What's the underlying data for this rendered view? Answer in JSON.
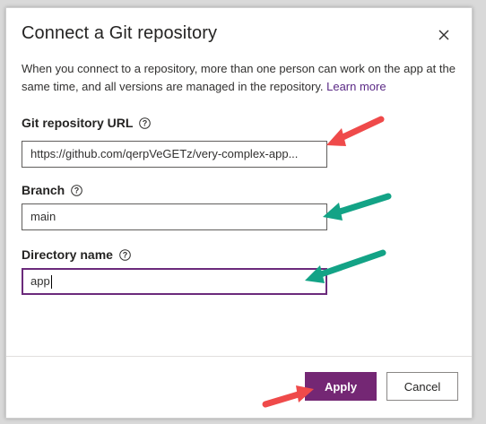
{
  "dialog": {
    "title": "Connect a Git repository",
    "description": "When you connect to a repository, more than one person can work on the app at the same time, and all versions are managed in the repository.",
    "learn_more": "Learn more"
  },
  "fields": {
    "repo_url": {
      "label": "Git repository URL",
      "value": "https://github.com/qerpVeGETz/very-complex-app..."
    },
    "branch": {
      "label": "Branch",
      "value": "main"
    },
    "directory": {
      "label": "Directory name",
      "value": "app"
    }
  },
  "buttons": {
    "apply": "Apply",
    "cancel": "Cancel"
  },
  "colors": {
    "primary": "#742774",
    "link": "#5b2a86",
    "arrow_red": "#ef4a4a",
    "arrow_green": "#13a386"
  },
  "icons": {
    "close": "close-icon",
    "help": "help-circle-icon"
  }
}
